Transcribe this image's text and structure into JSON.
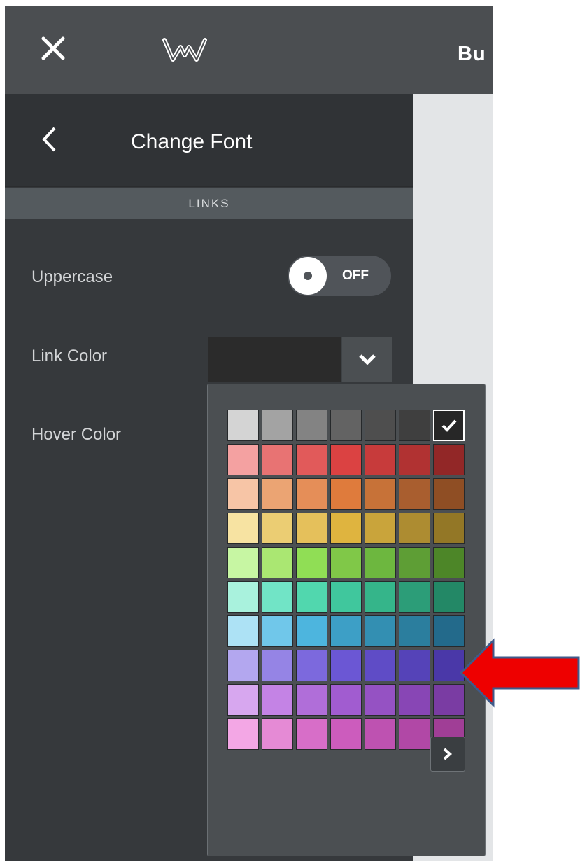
{
  "topbar": {
    "close_icon": "close-icon",
    "logo_icon": "weebly-logo-icon",
    "right_text": "Bu"
  },
  "sidebar": {
    "back_icon": "chevron-left-icon",
    "title": "Change Font",
    "section": "LINKS",
    "uppercase": {
      "label": "Uppercase",
      "toggle_text": "OFF",
      "on": false
    },
    "link_color": {
      "label": "Link Color",
      "value_color": "#2b2b2b"
    },
    "hover_color": {
      "label": "Hover Color"
    }
  },
  "palette": {
    "selected": [
      0,
      6
    ],
    "next_icon": "chevron-right-icon",
    "rows": [
      [
        "#d4d4d4",
        "#a3a3a3",
        "#838383",
        "#636363",
        "#4e4e4e",
        "#3f3f3f",
        "#272727"
      ],
      [
        "#f4a1a1",
        "#e87373",
        "#e15a5a",
        "#db4242",
        "#c73b3b",
        "#b13232",
        "#922727"
      ],
      [
        "#f7c5a6",
        "#eba473",
        "#e58e58",
        "#df7b3c",
        "#c77238",
        "#a95e2f",
        "#8f4e24"
      ],
      [
        "#f7e3a2",
        "#ebcd73",
        "#e5c05b",
        "#dfb43f",
        "#c9a43b",
        "#ad8c31",
        "#937726"
      ],
      [
        "#c7f6a3",
        "#aae772",
        "#90de55",
        "#80c848",
        "#6db73f",
        "#5e9e35",
        "#4d8628"
      ],
      [
        "#a9f2dd",
        "#71e4c6",
        "#51d7ae",
        "#40c79d",
        "#35b58a",
        "#2c9d78",
        "#238866"
      ],
      [
        "#ade2f5",
        "#70c7ea",
        "#4db5de",
        "#3d9fc6",
        "#338fb2",
        "#2b7e9e",
        "#236a8b"
      ],
      [
        "#b3a7ef",
        "#9584e5",
        "#7c69dd",
        "#6b57d4",
        "#5f4cc6",
        "#5543b8",
        "#4a38a8"
      ],
      [
        "#d7a7ef",
        "#c483e5",
        "#b06ed9",
        "#a15cd0",
        "#9552c3",
        "#8846b5",
        "#7a3ca3"
      ],
      [
        "#f3a7e5",
        "#e58ad5",
        "#d76ec8",
        "#cc5cbd",
        "#be52b1",
        "#b148a6",
        "#a03e96"
      ]
    ]
  },
  "annotation": {
    "arrow_color": "#ee0000",
    "arrow_border": "#3f5a8a",
    "arrow_icon": "red-arrow-icon"
  }
}
